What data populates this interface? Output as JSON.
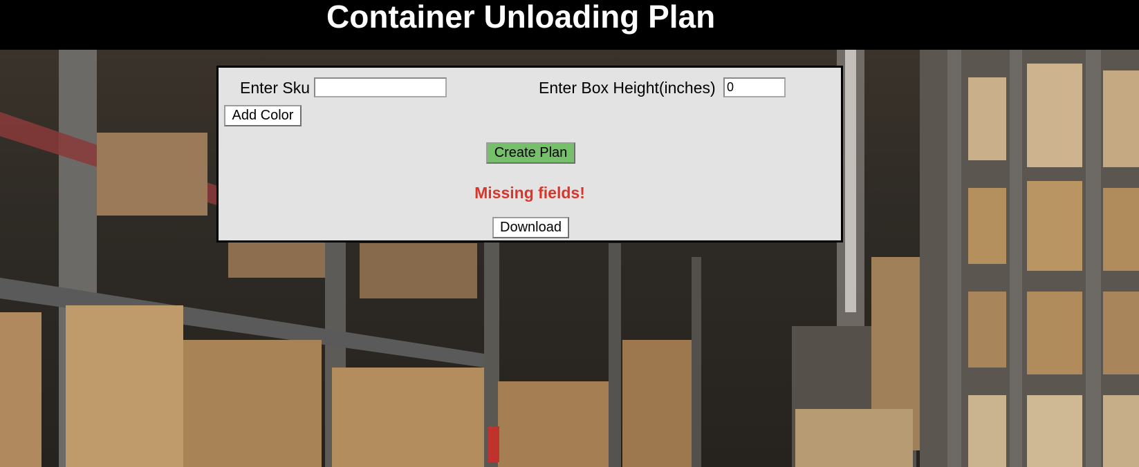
{
  "header": {
    "title": "Container Unloading Plan"
  },
  "form": {
    "sku_label": "Enter Sku",
    "sku_value": "",
    "box_height_label": "Enter Box Height(inches)",
    "box_height_value": "0",
    "add_color_label": "Add Color",
    "create_plan_label": "Create Plan",
    "error_message": "Missing fields!",
    "download_label": "Download"
  },
  "colors": {
    "header_bg": "#000000",
    "panel_bg": "#e3e3e3",
    "create_plan_bg": "#77c06b",
    "error_text": "#d9352a"
  }
}
